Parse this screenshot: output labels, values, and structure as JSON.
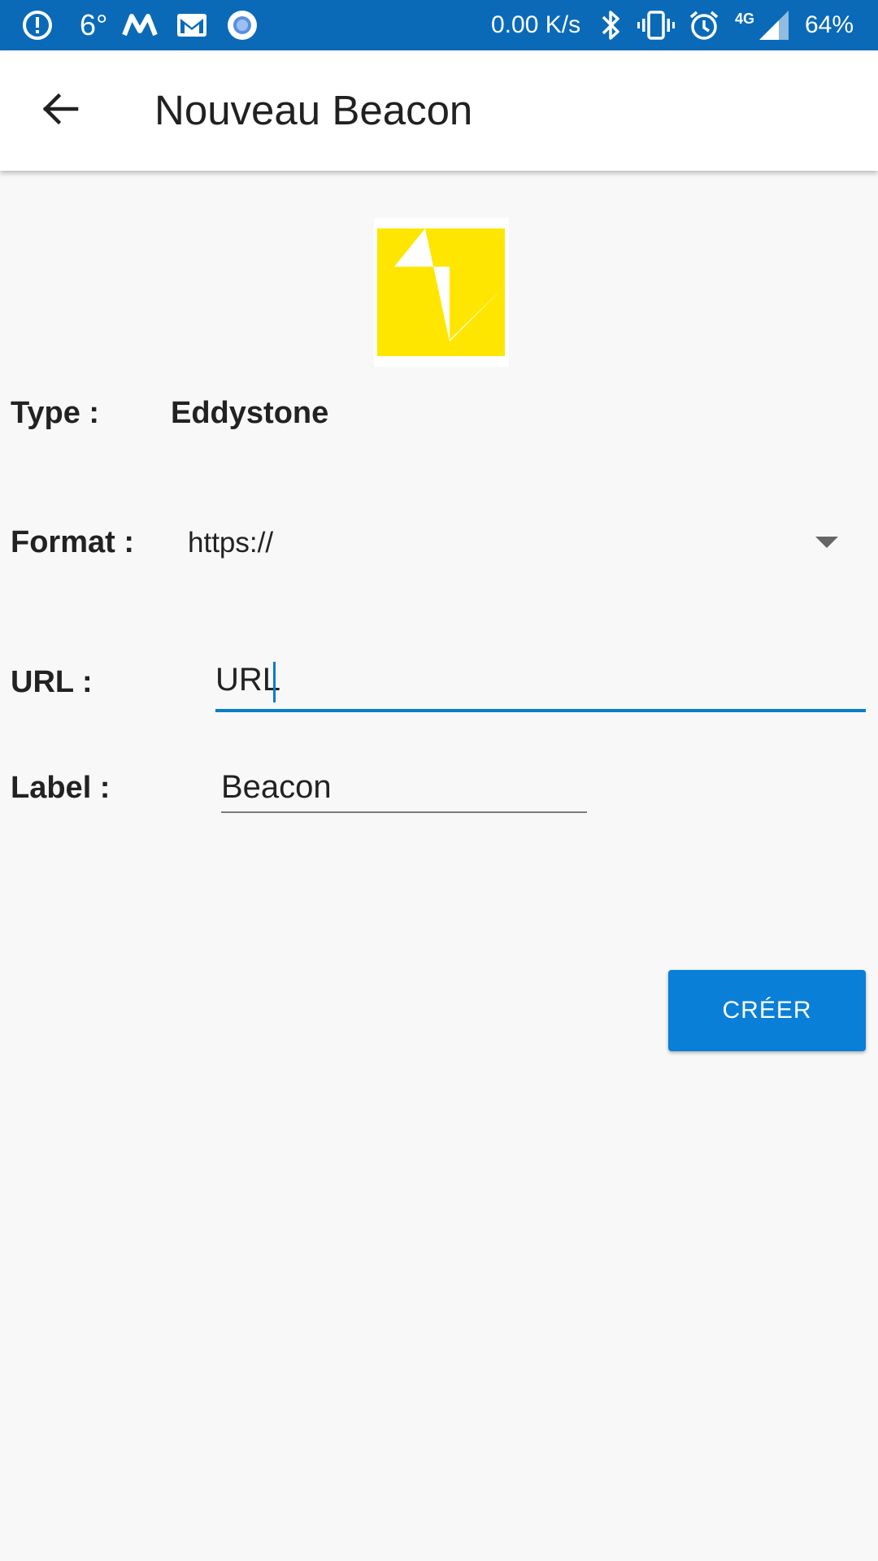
{
  "status_bar": {
    "temperature": "6°",
    "network_speed": "0.00 K/s",
    "network_type": "4G",
    "battery": "64%",
    "icons": [
      "alert-icon",
      "weather-icon",
      "maps-icon",
      "gmail-icon",
      "record-icon",
      "bluetooth-icon",
      "vibrate-icon",
      "alarm-icon",
      "signal-icon"
    ]
  },
  "app_bar": {
    "title": "Nouveau Beacon",
    "back_icon": "arrow-back-icon"
  },
  "logo": {
    "icon": "eddystone-logo",
    "color": "#FFE600"
  },
  "form": {
    "type_label": "Type :",
    "type_value": "Eddystone",
    "format_label": "Format :",
    "format_value": "https://",
    "url_label": "URL :",
    "url_value": "URL",
    "label_label": "Label :",
    "label_value": "Beacon"
  },
  "actions": {
    "create_label": "CRÉER"
  },
  "colors": {
    "status_bar": "#0A6AB8",
    "accent": "#0A7FD8",
    "background": "#F8F8F8"
  }
}
